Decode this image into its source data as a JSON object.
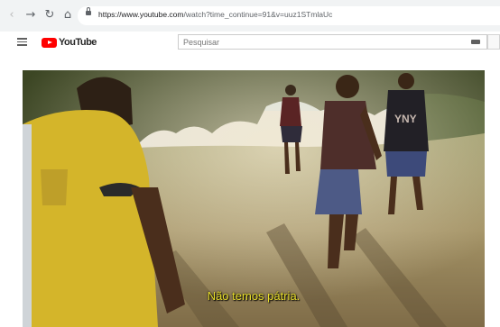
{
  "browser": {
    "url_host": "https://www.youtube.com",
    "url_path": "/watch?time_continue=91&v=uuz1STmlaUc",
    "icons": [
      "back-arrow-icon",
      "forward-arrow-icon",
      "reload-icon",
      "home-icon",
      "lock-icon"
    ]
  },
  "youtube": {
    "logo_text": "YouTube",
    "search_placeholder": "Pesquisar"
  },
  "video": {
    "subtitle": "Não temos pátria.",
    "colors": {
      "sky": "#d9e7ee",
      "trees": "#3e4a26",
      "grass": "#8f8a5c",
      "jersey_yellow": "#d4b52a",
      "subtitle": "#e8de2b"
    }
  }
}
